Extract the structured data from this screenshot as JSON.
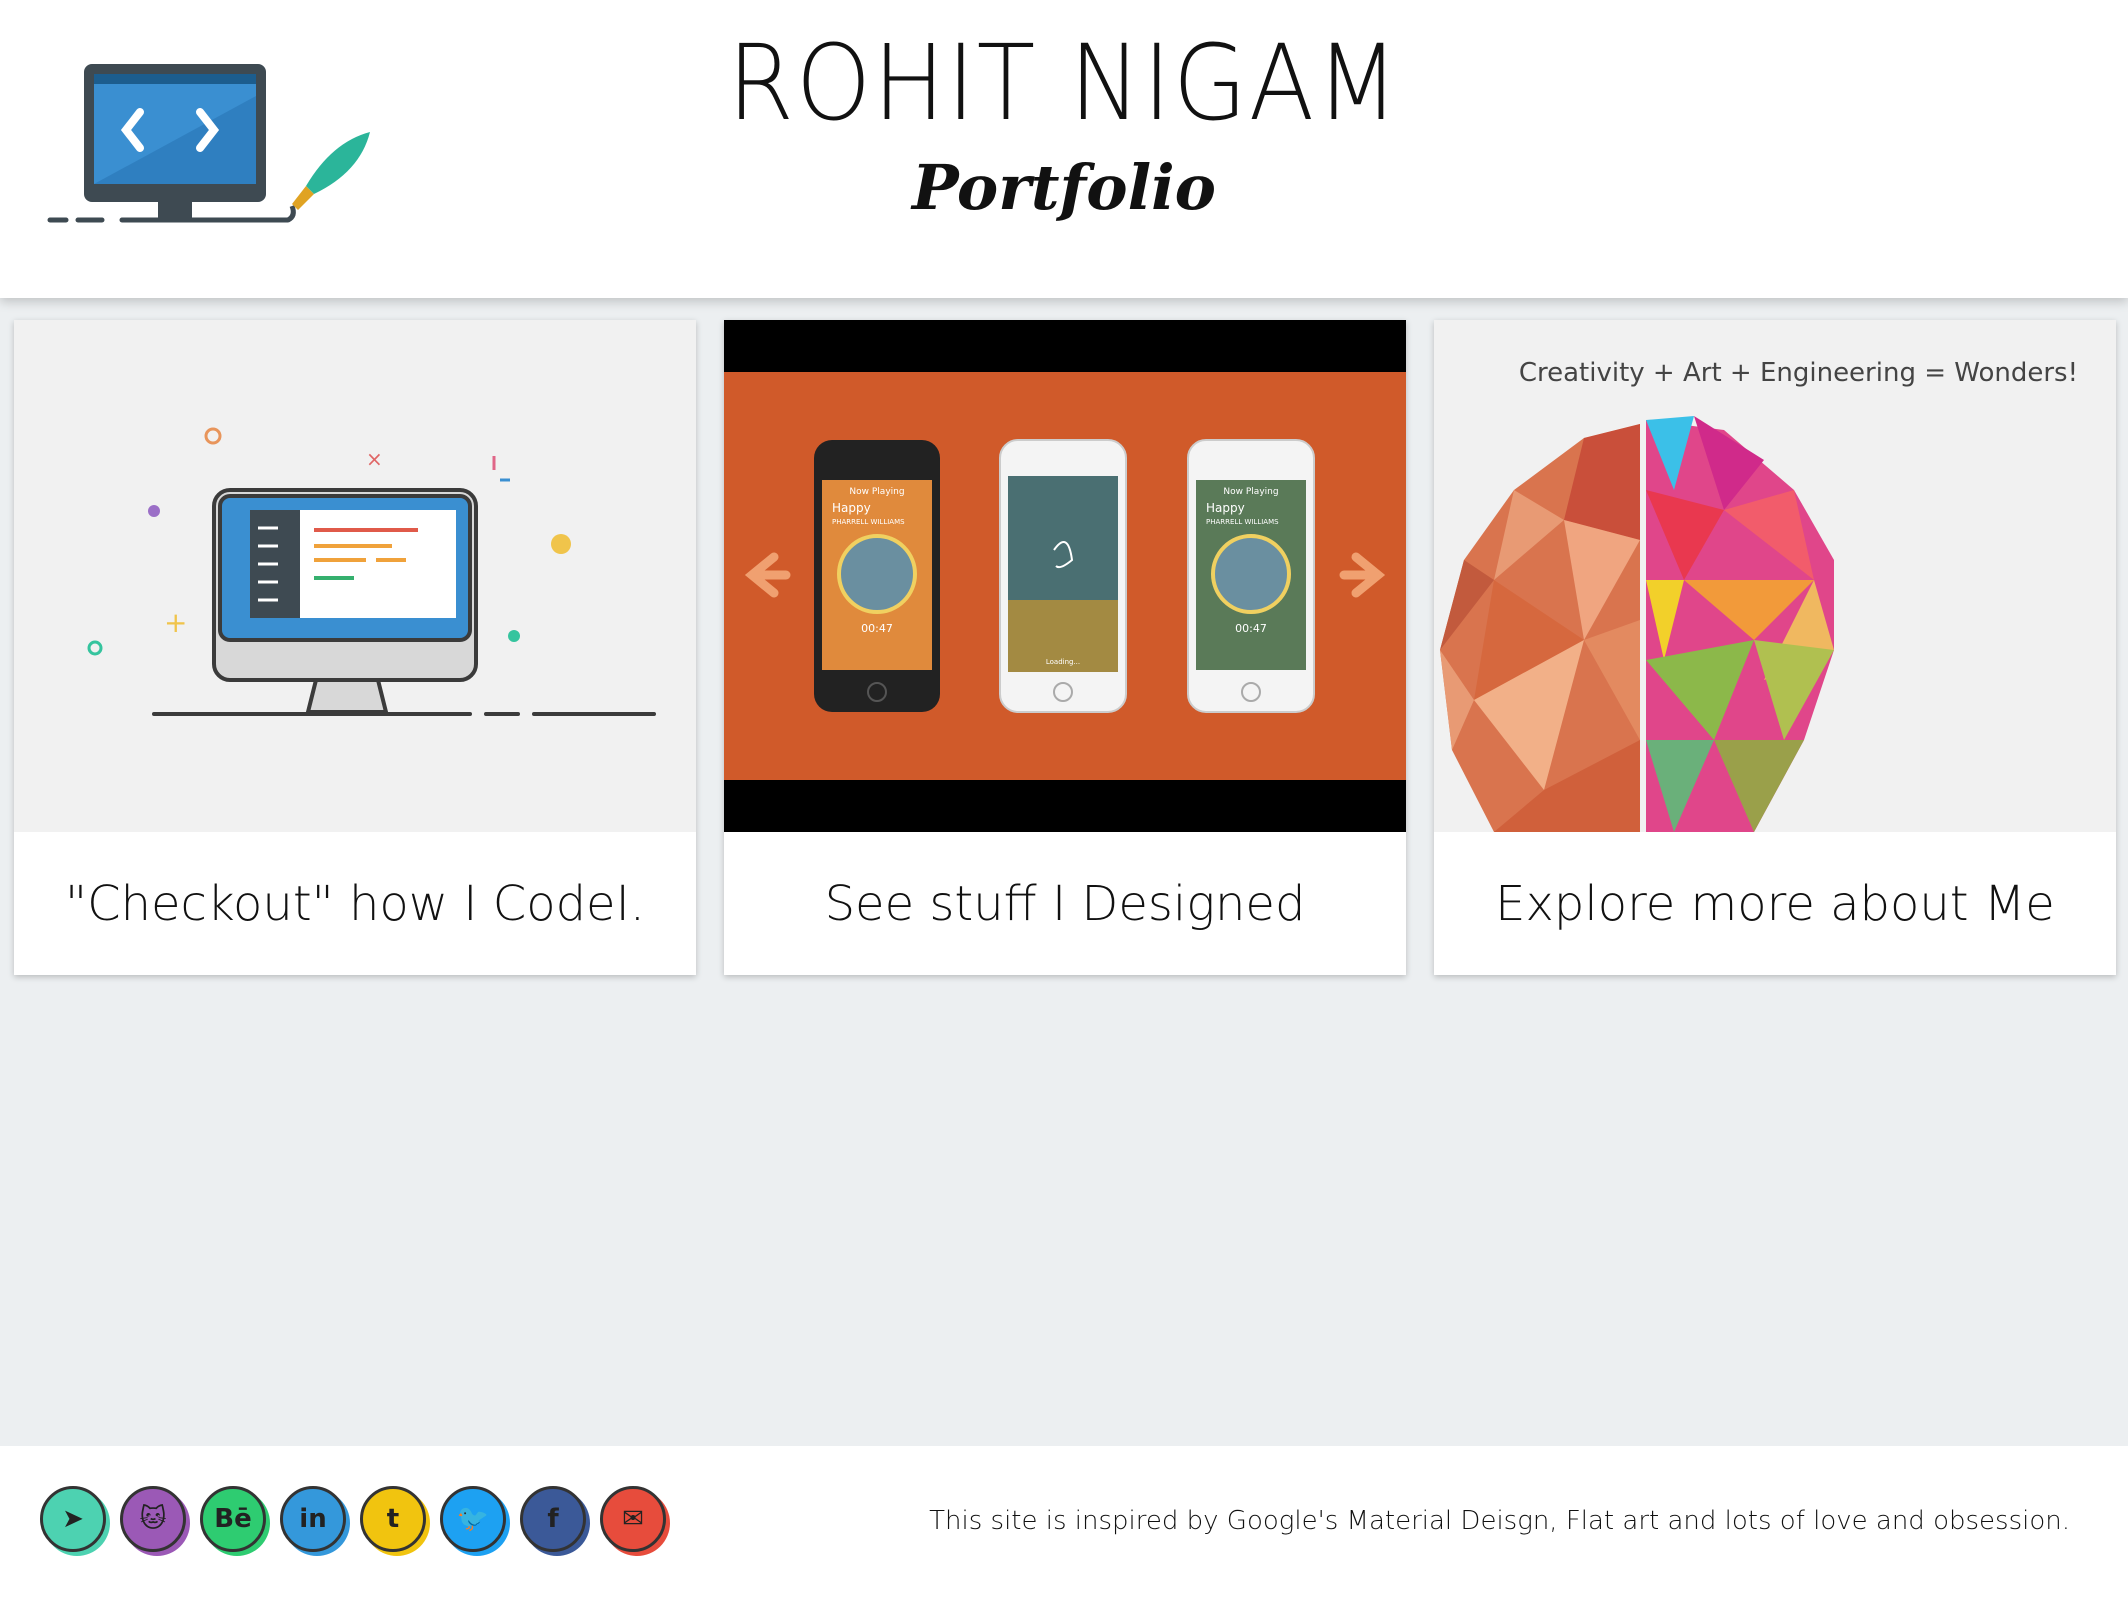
{
  "header": {
    "title": "ROHIT NIGAM",
    "subtitle": "Portfolio",
    "logo_icon": "monitor-code-brush-icon"
  },
  "cards": [
    {
      "caption": "\"Checkout\" how I CodeI.",
      "image_icon": "monitor-code-illustration"
    },
    {
      "caption": "See stuff I Designed",
      "image_icon": "phone-mockups-slider",
      "slider_prev_icon": "arrow-left-icon",
      "slider_next_icon": "arrow-right-icon"
    },
    {
      "caption": "Explore more about Me",
      "tagline": "Creativity + Art + Engineering = Wonders!",
      "image_icon": "polygon-brain-illustration"
    }
  ],
  "phone_screens": [
    {
      "header": "Now Playing",
      "song": "Happy",
      "artist": "PHARRELL WILLIAMS",
      "time": "00:47"
    },
    {
      "status": "Loading..."
    },
    {
      "header": "Now Playing",
      "song": "Happy",
      "artist": "PHARRELL WILLIAMS",
      "time": "00:47"
    }
  ],
  "footer": {
    "note": "This site is inspired by Google's Material Deisgn, Flat art and lots of love and obsession.",
    "social": [
      {
        "icon": "telegram-icon",
        "glyph": "➤",
        "color": "#4dd2b1"
      },
      {
        "icon": "github-icon",
        "glyph": "🐱",
        "color": "#9b59b6"
      },
      {
        "icon": "behance-icon",
        "glyph": "Bē",
        "color": "#2ecc71"
      },
      {
        "icon": "linkedin-icon",
        "glyph": "in",
        "color": "#3498db"
      },
      {
        "icon": "tumblr-icon",
        "glyph": "t",
        "color": "#f1c40f"
      },
      {
        "icon": "twitter-icon",
        "glyph": "🐦",
        "color": "#1da1f2"
      },
      {
        "icon": "facebook-icon",
        "glyph": "f",
        "color": "#3b5998"
      },
      {
        "icon": "mail-icon",
        "glyph": "✉",
        "color": "#e74c3c"
      }
    ]
  }
}
